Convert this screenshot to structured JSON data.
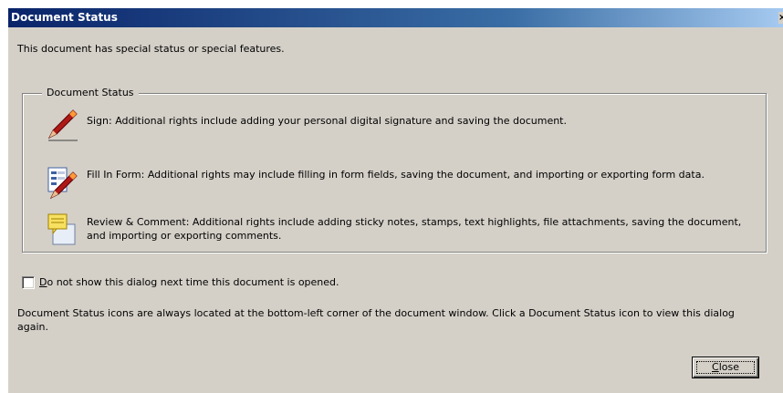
{
  "window": {
    "title": "Document Status",
    "close_glyph": "×"
  },
  "intro_text": "This document has special status or special features.",
  "group": {
    "legend": "Document Status",
    "items": [
      {
        "icon": "pen-signature-icon",
        "text": "Sign: Additional rights include adding your personal digital signature and saving the document."
      },
      {
        "icon": "fill-form-icon",
        "text": "Fill In Form: Additional rights may include filling in form fields, saving the document, and importing or exporting form data."
      },
      {
        "icon": "sticky-note-icon",
        "text": "Review & Comment: Additional rights include adding sticky notes, stamps, text highlights, file attachments, saving the document, and importing or exporting comments."
      }
    ]
  },
  "checkbox": {
    "checked": false,
    "mnemonic": "D",
    "label_rest": "o not show this dialog next time this document is opened."
  },
  "footer_text": "Document Status icons are always located at the bottom-left corner of the document window. Click a Document Status icon to view this dialog again.",
  "close_button": {
    "mnemonic": "C",
    "label_rest": "lose"
  }
}
